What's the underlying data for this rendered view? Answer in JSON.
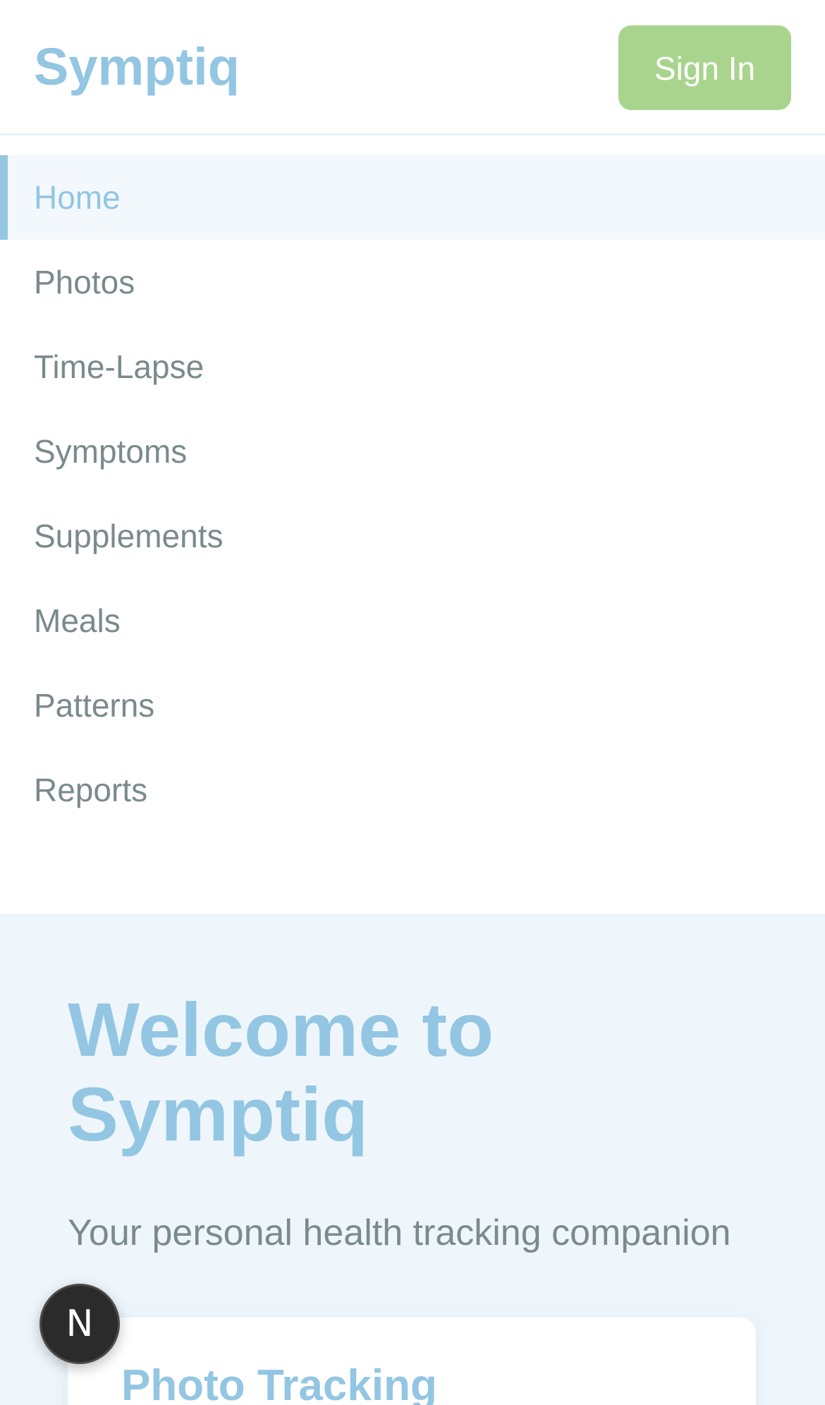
{
  "header": {
    "brand": "Symptiq",
    "sign_in_label": "Sign In"
  },
  "nav": {
    "items": [
      {
        "label": "Home",
        "active": true
      },
      {
        "label": "Photos",
        "active": false
      },
      {
        "label": "Time-Lapse",
        "active": false
      },
      {
        "label": "Symptoms",
        "active": false
      },
      {
        "label": "Supplements",
        "active": false
      },
      {
        "label": "Meals",
        "active": false
      },
      {
        "label": "Patterns",
        "active": false
      },
      {
        "label": "Reports",
        "active": false
      }
    ]
  },
  "hero": {
    "title": "Welcome to Symptiq",
    "subtitle": "Your personal health tracking companion"
  },
  "cards": [
    {
      "title": "Photo Tracking"
    }
  ],
  "fab": {
    "label": "N",
    "icon": "nextjs-dev-indicator-icon"
  },
  "colors": {
    "brand": "#93c6e2",
    "accent": "#a9d48e",
    "text_muted": "#7a8a8d",
    "hero_bg": "#eef6fc",
    "active_bg": "#f2f8fc"
  }
}
